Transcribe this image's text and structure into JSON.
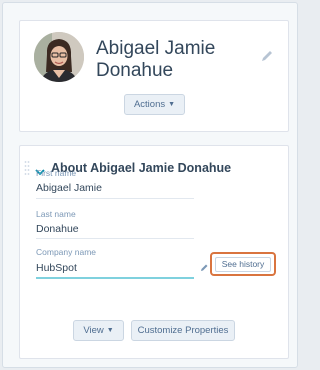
{
  "contact": {
    "name": "Abigael Jamie Donahue",
    "actions_label": "Actions",
    "avatar_icon": "contact-photo",
    "edit_icon": "pencil-icon"
  },
  "about": {
    "title": "About Abigael Jamie Donahue",
    "fields": [
      {
        "label": "First name",
        "value": "Abigael Jamie"
      },
      {
        "label": "Last name",
        "value": "Donahue"
      },
      {
        "label": "Company name",
        "value": "HubSpot"
      }
    ],
    "see_history_label": "See history",
    "view_label": "View",
    "customize_label": "Customize Properties"
  },
  "colors": {
    "highlight": "#d9743f",
    "field_focus": "#7fd1de",
    "button_bg": "#eaf0f6"
  }
}
